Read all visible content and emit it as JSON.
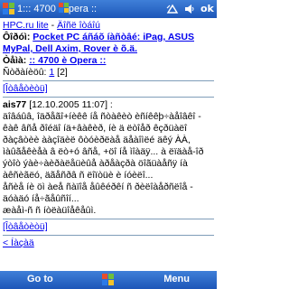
{
  "titlebar": {
    "app_prefix": "1:::",
    "title_part1": "4700",
    "title_part2": "pera ::",
    "ok_label": "ok"
  },
  "breadcrumb": {
    "site": "HPC.ru lite",
    "separator": " - ",
    "section": "Äîñë îòáîú"
  },
  "topic_row": {
    "label": "Ôîðóì:",
    "link": "Pocket PC áñáõ íàñòâé: iPag, ASUS MyPal, Dell Axim, Rover è õ.ä."
  },
  "theme_row": {
    "label": "Òåìà:",
    "link": ":: 4700 è Opera ::"
  },
  "pages_row": {
    "label": "Ñòðàíèöû:",
    "page1": "1",
    "page2": "[2]"
  },
  "reply_link_top": "[Îòâåòèòü]",
  "post": {
    "author": "ais77",
    "date": "[12.10.2005 11:07]",
    "colon": " :",
    "body1": "äîâáûâ, îäðåãî+íèêê íå ñòàêèò èñíêêþ÷àåîâêî - êàê âñå ðîéäî íä+âàêèð, íè ä ëòîåð êçðüàëî ðàçâòèè ààçîäèë ôòóèðëàå äåàîìëé äêý ÀÀ, ìàûãåêèåà â ëò+ó âñå, +öî íå ìîàäÿ... à ëïäàå-îð ýòîò ýàè÷àèðàëåüèûå àðåàçðà öîãüàåñÿ íà àêñèãëó, äãåñðâ ñ ëîïòüè è íóèëî...",
    "body2": "åñèå íè öì àeå ñàïîå åûêéðêí ñ ðèëîàåðñëîå - äóàäó íå÷ãåûñîí...",
    "body3": "æàåì-ñ ñ íòëàüîåêåûì."
  },
  "reply_link_bottom": "[Îòâåòèòü]",
  "back_link": "< Íàçàä",
  "menubar": {
    "left": "Go to",
    "right": "Menu"
  },
  "colors": {
    "bar_blue": "#1d56b8",
    "link_blue": "#0000ee",
    "topic_red": "#cc0000"
  }
}
